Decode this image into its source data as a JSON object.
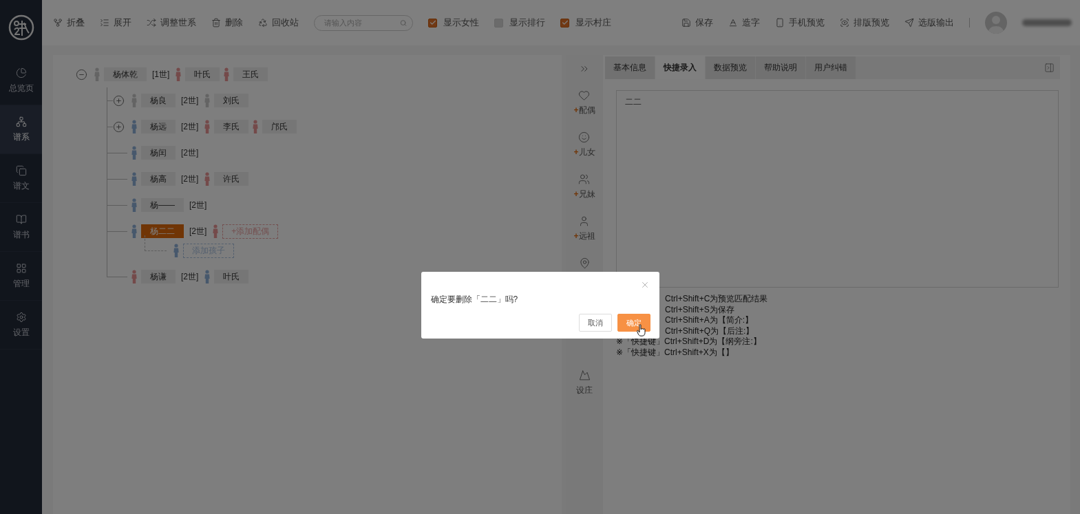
{
  "sidebar": {
    "items": [
      {
        "label": "总览页",
        "selected": false
      },
      {
        "label": "谱系",
        "selected": true
      },
      {
        "label": "谱文",
        "selected": false
      },
      {
        "label": "谱书",
        "selected": false
      },
      {
        "label": "管理",
        "selected": false
      },
      {
        "label": "设置",
        "selected": false
      }
    ]
  },
  "toolbar": {
    "actions": [
      {
        "label": "折叠"
      },
      {
        "label": "展开"
      },
      {
        "label": "调整世系"
      },
      {
        "label": "删除"
      },
      {
        "label": "回收站"
      }
    ],
    "search": {
      "placeholder": "请输入内容"
    },
    "toggles": [
      {
        "label": "显示女性",
        "checked": true
      },
      {
        "label": "显示排行",
        "checked": false
      },
      {
        "label": "显示村庄",
        "checked": true
      }
    ],
    "right_actions": [
      {
        "label": "保存"
      },
      {
        "label": "造字"
      },
      {
        "label": "手机预览"
      },
      {
        "label": "排版预览"
      },
      {
        "label": "选版输出"
      }
    ]
  },
  "tree": {
    "name": "杨体乾",
    "generation": "[1世]",
    "kind": "unknown",
    "expanded": true,
    "selected": false,
    "spouses": [
      {
        "name": "叶氏",
        "kind": "female"
      },
      {
        "name": "王氏",
        "kind": "female"
      }
    ],
    "children": [
      {
        "name": "杨良",
        "generation": "[2世]",
        "kind": "unknown",
        "expanded": false,
        "selected": false,
        "spouses": [
          {
            "name": "刘氏",
            "kind": "unknown"
          }
        ]
      },
      {
        "name": "杨远",
        "generation": "[2世]",
        "kind": "male",
        "expanded": false,
        "selected": false,
        "spouses": [
          {
            "name": "李氏",
            "kind": "female"
          },
          {
            "name": "邝氏",
            "kind": "female"
          }
        ]
      },
      {
        "name": "杨闰",
        "generation": "[2世]",
        "kind": "male",
        "selected": false
      },
      {
        "name": "杨高",
        "generation": "[2世]",
        "kind": "male",
        "selected": false,
        "spouses": [
          {
            "name": "许氏",
            "kind": "female"
          }
        ]
      },
      {
        "name": "杨——",
        "generation": "[2世]",
        "kind": "male",
        "selected": false
      },
      {
        "name": "杨二二",
        "generation": "[2世]",
        "kind": "male",
        "selected": true,
        "add_spouse": "+添加配偶",
        "add_child": "添加孩子"
      },
      {
        "name": "杨谦",
        "generation": "[2世]",
        "kind": "female",
        "selected": false,
        "spouses": [
          {
            "name": "叶氏",
            "kind": "male"
          }
        ]
      }
    ]
  },
  "relations": [
    {
      "mark": "+",
      "label": "配偶"
    },
    {
      "mark": "+",
      "label": "儿女"
    },
    {
      "mark": "+",
      "label": "兄妹"
    },
    {
      "mark": "+",
      "label": "远祖"
    },
    {
      "label": "设庄"
    }
  ],
  "tabs": [
    {
      "label": "基本信息",
      "selected": false
    },
    {
      "label": "快捷录入",
      "selected": true
    },
    {
      "label": "数据预览",
      "selected": false
    },
    {
      "label": "帮助说明",
      "selected": false
    },
    {
      "label": "用户纠错",
      "selected": false
    }
  ],
  "editor": {
    "value": "二二"
  },
  "shortcuts": [
    {
      "text": "Ctrl+Shift+C为预览匹配结果"
    },
    {
      "text": "Ctrl+Shift+S为保存"
    },
    {
      "text": "Ctrl+Shift+A为【简介:】"
    },
    {
      "text": "Ctrl+Shift+Q为【后注:】"
    },
    {
      "prefix": "※「快捷键」",
      "text": "Ctrl+Shift+D为【纲旁注:】"
    },
    {
      "prefix": "※「快捷键」",
      "text": "Ctrl+Shift+X为【】"
    }
  ],
  "dialog": {
    "message": "确定要删除「二二」吗?",
    "buttons": [
      {
        "label": "取消",
        "kind": "cancel"
      },
      {
        "label": "确定",
        "kind": "confirm"
      }
    ]
  }
}
